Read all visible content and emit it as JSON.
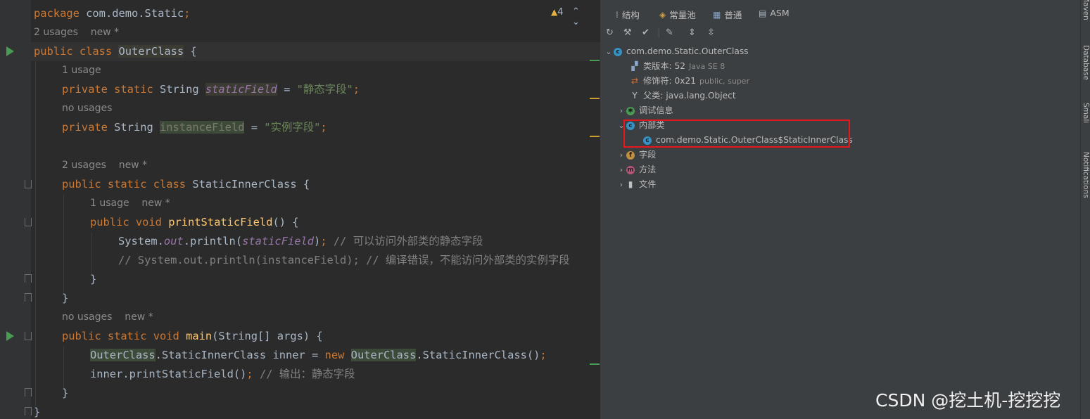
{
  "editor": {
    "warning_count": "4",
    "nav_arrows": "⌃ ⌄",
    "lines": {
      "l1": {
        "kw": "package ",
        "rest": "com.demo.Static",
        "semi": ";"
      },
      "l2": {
        "hint": "2 usages    new *"
      },
      "l3": {
        "kw": "public class ",
        "cls": "OuterClass",
        "rest": " {"
      },
      "l4": {
        "hint": "1 usage"
      },
      "l5": {
        "kw": "private static ",
        "type": "String ",
        "field": "staticField",
        "eq": " = ",
        "str": "\"静态字段\"",
        "semi": ";"
      },
      "l6": {
        "hint": "no usages"
      },
      "l7": {
        "kw": "private ",
        "type": "String ",
        "field": "instanceField",
        "eq": " = ",
        "str": "\"实例字段\"",
        "semi": ";"
      },
      "l9": {
        "hint": "2 usages    new *"
      },
      "l10": {
        "kw": "public static class ",
        "cls": "StaticInnerClass",
        "rest": " {"
      },
      "l11": {
        "hint": "1 usage    new *"
      },
      "l12": {
        "kw": "public void ",
        "method": "printStaticField",
        "rest": "() {"
      },
      "l13": {
        "pre": "System.",
        "out": "out",
        "mid": ".println(",
        "field": "staticField",
        "close": ")",
        "semi": "; ",
        "cmt": "// 可以访问外部类的静态字段"
      },
      "l14": {
        "cmt": "// System.out.println(instanceField); // 编译错误，不能访问外部类的实例字段"
      },
      "l15": {
        "rest": "}"
      },
      "l16": {
        "rest": "}"
      },
      "l17": {
        "hint": "no usages    new *"
      },
      "l18": {
        "kw": "public static void ",
        "method": "main",
        "rest": "(String[] args) {"
      },
      "l19": {
        "c1": "OuterClass",
        "t1": ".StaticInnerClass inner = ",
        "kw": "new ",
        "c2": "OuterClass",
        "t2": ".StaticInnerClass()",
        "semi": ";"
      },
      "l20": {
        "t1": "inner.printStaticField()",
        "semi": "; ",
        "cmt": "// 输出：静态字段"
      },
      "l21": {
        "rest": "}"
      },
      "l22": {
        "rest": "}"
      }
    }
  },
  "panel": {
    "tabs": [
      {
        "label": "结构",
        "icon": "structure-icon"
      },
      {
        "label": "常量池",
        "icon": "constant-pool-icon"
      },
      {
        "label": "普通",
        "icon": "general-icon"
      },
      {
        "label": "ASM",
        "icon": "asm-icon"
      }
    ],
    "toolbar": [
      "refresh-icon",
      "hammer-icon",
      "check-icon",
      "edit-icon",
      "expand-all-icon",
      "collapse-all-icon"
    ],
    "tree": {
      "root": "com.demo.Static.OuterClass",
      "class_version_label": "类版本:",
      "class_version_value": "52",
      "class_version_sub": "Java SE 8",
      "modifiers_label": "修饰符:",
      "modifiers_value": "0x21",
      "modifiers_sub": "public, super",
      "super_label": "父类:",
      "super_value": "java.lang.Object",
      "debug_info": "调试信息",
      "inner_classes": "内部类",
      "inner_class_item": "com.demo.Static.OuterClass$StaticInnerClass",
      "fields": "字段",
      "methods": "方法",
      "files": "文件"
    }
  },
  "right_toolbar": [
    "Maven",
    "Database",
    "Smali",
    "Notifications"
  ],
  "watermark": "CSDN @挖土机-挖挖挖"
}
